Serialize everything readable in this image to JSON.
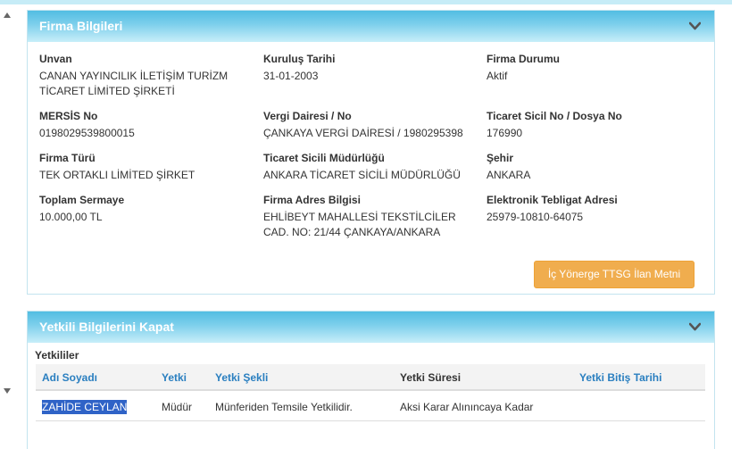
{
  "firma": {
    "title": "Firma Bilgileri",
    "unvan_label": "Unvan",
    "unvan_line1": "CANAN YAYINCILIK İLETİŞİM TURİZM",
    "unvan_line2": "TİCARET LİMİTED ŞİRKETİ",
    "kurulus_label": "Kuruluş Tarihi",
    "kurulus_value": "31-01-2003",
    "durum_label": "Firma Durumu",
    "durum_value": "Aktif",
    "mersis_label": "MERSİS No",
    "mersis_value": "0198029539800015",
    "vergi_label": "Vergi Dairesi / No",
    "vergi_value": "ÇANKAYA VERGİ DAİRESİ / 1980295398",
    "sicil_label": "Ticaret Sicil No / Dosya No",
    "sicil_value": "176990",
    "tur_label": "Firma Türü",
    "tur_value": "TEK ORTAKLI LİMİTED ŞİRKET",
    "mudurluk_label": "Ticaret Sicili Müdürlüğü",
    "mudurluk_value": "ANKARA TİCARET SİCİLİ MÜDÜRLÜĞÜ",
    "sehir_label": "Şehir",
    "sehir_value": "ANKARA",
    "sermaye_label": "Toplam Sermaye",
    "sermaye_value": "10.000,00 TL",
    "adres_label": "Firma Adres Bilgisi",
    "adres_line1": "EHLİBEYT MAHALLESİ TEKSTİLCİLER",
    "adres_line2": "CAD. NO: 21/44 ÇANKAYA/ANKARA",
    "tebligat_label": "Elektronik Tebligat Adresi",
    "tebligat_value": "25979-10810-64075",
    "button_label": "İç Yönerge TTSG İlan Metni"
  },
  "yetkili": {
    "title": "Yetkili Bilgilerini Kapat",
    "subtitle": "Yetkililer",
    "columns": [
      "Adı Soyadı",
      "Yetki",
      "Yetki Şekli",
      "Yetki Süresi",
      "Yetki Bitiş Tarihi"
    ],
    "rows": [
      [
        "ZAHİDE CEYLAN",
        "Müdür",
        "Münferiden Temsile Yetkilidir.",
        "Aksi Karar Alınıncaya Kadar",
        ""
      ]
    ]
  },
  "colors": {
    "header_blue": "#52bde2",
    "link_blue": "#2a7fc0",
    "button_orange": "#f0ad4e",
    "selection": "#2f63c7"
  }
}
